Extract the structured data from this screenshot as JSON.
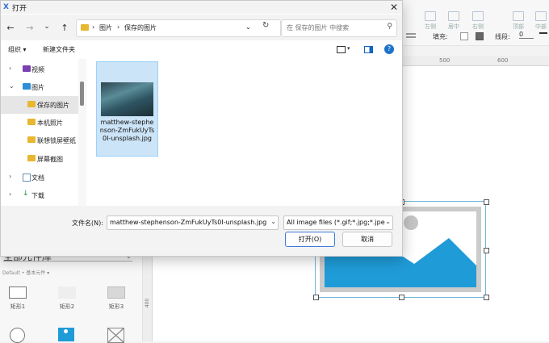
{
  "dialog": {
    "title": "打开",
    "close_glyph": "✕",
    "nav": {
      "back": "←",
      "forward": "→",
      "recent": "⌄",
      "up": "↑",
      "refresh": "↻"
    },
    "breadcrumb": [
      "图片",
      "保存的图片"
    ],
    "breadcrumb_sep": "›",
    "search_placeholder": "在 保存的图片 中搜索",
    "toolbar": {
      "organize": "组织 ▾",
      "new_folder": "新建文件夹"
    },
    "sidebar": [
      {
        "label": "视频",
        "chevron": "›",
        "icon": "video-icon"
      },
      {
        "label": "图片",
        "chevron": "⌄",
        "icon": "pictures-icon"
      },
      {
        "label": "保存的图片",
        "icon": "folder-icon",
        "selected": true
      },
      {
        "label": "本机照片",
        "icon": "folder-icon"
      },
      {
        "label": "联想锁屏壁纸",
        "icon": "folder-icon"
      },
      {
        "label": "屏幕截图",
        "icon": "folder-icon"
      },
      {
        "label": "文档",
        "chevron": "›",
        "icon": "document-icon"
      },
      {
        "label": "下载",
        "chevron": "›",
        "icon": "download-icon"
      }
    ],
    "file": {
      "name": "matthew-stephenson-ZmFukUyTs0I-unsplash.jpg"
    },
    "footer": {
      "filename_label": "文件名(N):",
      "filename_value": "matthew-stephenson-ZmFukUyTs0I-unsplash.jpg",
      "filetype_value": "All image files (*.gif;*.jpg;*.jpe",
      "open_label": "打开(O)",
      "cancel_label": "取消"
    }
  },
  "background_app": {
    "toolbar_labels": [
      "左侧",
      "居中",
      "右侧",
      "顶部",
      "中部"
    ],
    "fill_label": "填充:",
    "line_label": "线段:",
    "line_value": "0",
    "ruler_ticks": [
      "500",
      "600"
    ],
    "vruler_tick": "400",
    "library_title": "全部元件库",
    "library_sub": "Default • 基本元件 ▾",
    "widgets": [
      "矩形1",
      "矩形2",
      "矩形3"
    ]
  },
  "colors": {
    "accent": "#0078d4",
    "selection": "#cce4f7",
    "image_blue": "#1f9bd7"
  }
}
